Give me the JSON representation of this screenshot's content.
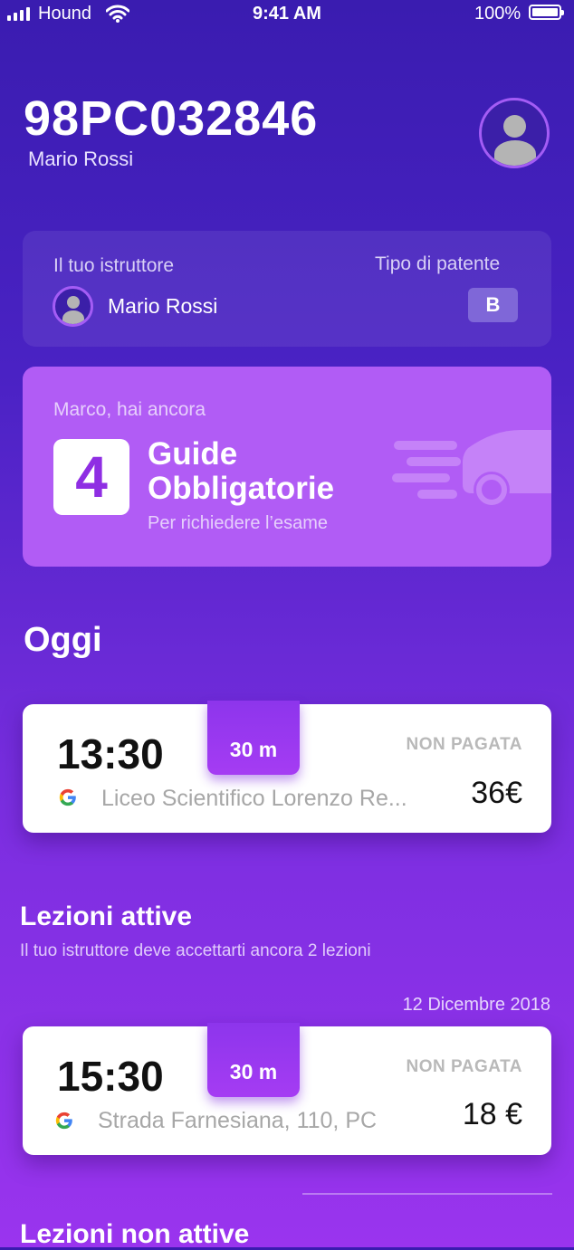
{
  "status_bar": {
    "carrier": "Hound",
    "time": "9:41 AM",
    "battery": "100%"
  },
  "header": {
    "plate": "98PC032846",
    "owner_name": "Mario Rossi"
  },
  "instructor_card": {
    "instructor_label": "Il tuo istruttore",
    "instructor_name": "Mario Rossi",
    "license_label": "Tipo di patente",
    "license_type": "B"
  },
  "guides_card": {
    "intro": "Marco, hai ancora",
    "count": "4",
    "label_line1": "Guide",
    "label_line2": "Obbligatorie",
    "subtitle": "Per richiedere l’esame"
  },
  "today": {
    "title": "Oggi",
    "lesson": {
      "time": "13:30",
      "duration": "30 m",
      "payment_status": "NON PAGATA",
      "location": "Liceo Scientifico Lorenzo Re...",
      "price": "36€"
    }
  },
  "active_lessons": {
    "title": "Lezioni attive",
    "subtitle": "Il tuo istruttore deve accettarti ancora 2 lezioni",
    "date": "12 Dicembre 2018",
    "lesson": {
      "time": "15:30",
      "duration": "30 m",
      "payment_status": "NON PAGATA",
      "location": "Strada Farnesiana, 110, PC",
      "price": "18 €"
    }
  },
  "inactive_lessons": {
    "title": "Lezioni non attive"
  },
  "icons": [
    "signal-icon",
    "wifi-icon",
    "battery-icon",
    "avatar-icon",
    "car-icon",
    "google-icon"
  ],
  "colors": {
    "accent": "#9a34ee",
    "card_purple": "#b15cf5",
    "badge": "#7f67d8"
  }
}
